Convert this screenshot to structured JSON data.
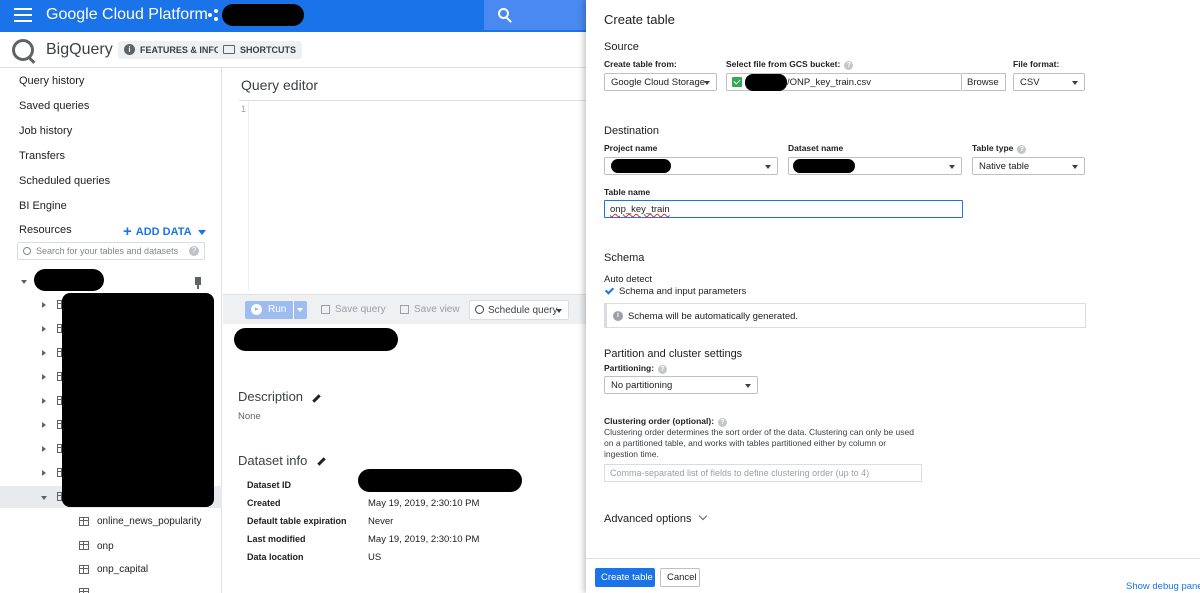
{
  "topbar": {
    "title": "Google Cloud Platform"
  },
  "subheader": {
    "product": "BigQuery",
    "features_label": "FEATURES & INFO",
    "shortcuts_label": "SHORTCUTS"
  },
  "sidebar": {
    "nav": [
      "Query history",
      "Saved queries",
      "Job history",
      "Transfers",
      "Scheduled queries",
      "BI Engine",
      "Resources"
    ],
    "add_data": "ADD DATA",
    "search_placeholder": "Search for your tables and datasets",
    "tables": [
      "online_news_popularity",
      "onp",
      "onp_capital"
    ]
  },
  "editor": {
    "title": "Query editor",
    "line_number": "1",
    "toolbar": {
      "run": "Run",
      "save_query": "Save query",
      "save_view": "Save view",
      "schedule_query": "Schedule query"
    },
    "description_title": "Description",
    "description_value": "None",
    "dataset_info_title": "Dataset info",
    "dataset_info": [
      {
        "key": "Dataset ID",
        "value": ""
      },
      {
        "key": "Created",
        "value": "May 19, 2019, 2:30:10 PM"
      },
      {
        "key": "Default table expiration",
        "value": "Never"
      },
      {
        "key": "Last modified",
        "value": "May 19, 2019, 2:30:10 PM"
      },
      {
        "key": "Data location",
        "value": "US"
      }
    ]
  },
  "create_table": {
    "title": "Create table",
    "source": {
      "heading": "Source",
      "create_from_label": "Create table from:",
      "create_from_value": "Google Cloud Storage",
      "gcs_label": "Select file from GCS bucket:",
      "gcs_value": "/ONP_key_train.csv",
      "browse": "Browse",
      "format_label": "File format:",
      "format_value": "CSV"
    },
    "destination": {
      "heading": "Destination",
      "project_label": "Project name",
      "dataset_label": "Dataset name",
      "type_label": "Table type",
      "type_value": "Native table",
      "table_name_label": "Table name",
      "table_name_value": "onp_key_train"
    },
    "schema": {
      "heading": "Schema",
      "auto_detect": "Auto detect",
      "checkbox_label": "Schema and input parameters",
      "info": "Schema will be automatically generated."
    },
    "partition": {
      "heading": "Partition and cluster settings",
      "partitioning_label": "Partitioning:",
      "partitioning_value": "No partitioning",
      "clustering_label": "Clustering order (optional):",
      "clustering_help": "Clustering order determines the sort order of the data. Clustering can only be used on a partitioned table, and works with tables partitioned either by column or ingestion time.",
      "clustering_placeholder": "Comma-separated list of fields to define clustering order (up to 4)"
    },
    "advanced": "Advanced options",
    "create_button": "Create table",
    "cancel_button": "Cancel",
    "debug_link": "Show debug panel"
  }
}
